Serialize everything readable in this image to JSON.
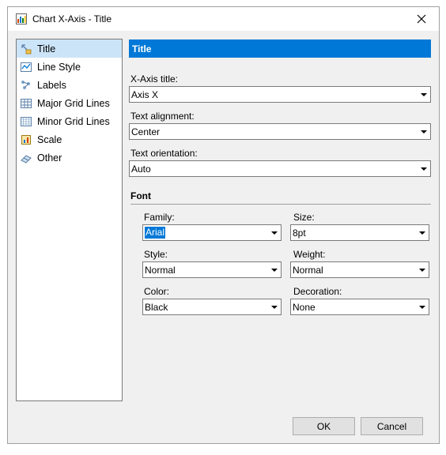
{
  "window": {
    "title": "Chart X-Axis - Title"
  },
  "nav": {
    "items": [
      {
        "label": "Title",
        "icon": "title-icon",
        "selected": true
      },
      {
        "label": "Line Style",
        "icon": "line-style-icon"
      },
      {
        "label": "Labels",
        "icon": "labels-icon"
      },
      {
        "label": "Major Grid Lines",
        "icon": "major-grid-icon"
      },
      {
        "label": "Minor Grid Lines",
        "icon": "minor-grid-icon"
      },
      {
        "label": "Scale",
        "icon": "scale-icon"
      },
      {
        "label": "Other",
        "icon": "other-icon"
      }
    ]
  },
  "panel": {
    "header": "Title",
    "xaxis_title": {
      "label": "X-Axis title:",
      "value": "Axis X"
    },
    "text_alignment": {
      "label": "Text alignment:",
      "value": "Center"
    },
    "text_orientation": {
      "label": "Text orientation:",
      "value": "Auto"
    }
  },
  "font": {
    "header": "Font",
    "family": {
      "label": "Family:",
      "value": "Arial"
    },
    "size": {
      "label": "Size:",
      "value": "8pt"
    },
    "style": {
      "label": "Style:",
      "value": "Normal"
    },
    "weight": {
      "label": "Weight:",
      "value": "Normal"
    },
    "color": {
      "label": "Color:",
      "value": "Black"
    },
    "decoration": {
      "label": "Decoration:",
      "value": "None"
    }
  },
  "buttons": {
    "ok": "OK",
    "cancel": "Cancel"
  },
  "colors": {
    "accent": "#0078d7",
    "selection": "#cce4f7"
  }
}
